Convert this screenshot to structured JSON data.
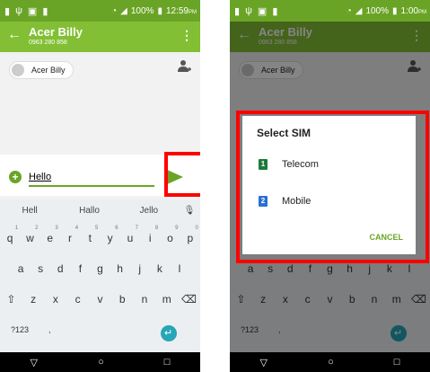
{
  "left": {
    "status": {
      "time": "12:59",
      "ampm": "PM",
      "battery": "100%"
    },
    "appbar": {
      "back": "←",
      "title": "Acer Billy",
      "subtitle": "0963 280 858",
      "menu": "⋮"
    },
    "recipient": {
      "chip": "Acer Billy"
    },
    "compose": {
      "plus": "+",
      "message": "Hello"
    },
    "suggestions": [
      "Hell",
      "Hallo",
      "Jello"
    ],
    "row1": [
      "q",
      "w",
      "e",
      "r",
      "t",
      "y",
      "u",
      "i",
      "o",
      "p"
    ],
    "row1_nums": [
      "1",
      "2",
      "3",
      "4",
      "5",
      "6",
      "7",
      "8",
      "9",
      "0"
    ],
    "row2": [
      "a",
      "s",
      "d",
      "f",
      "g",
      "h",
      "j",
      "k",
      "l"
    ],
    "row3": [
      "z",
      "x",
      "c",
      "v",
      "b",
      "n",
      "m"
    ],
    "sym": "?123",
    "comma": ","
  },
  "right": {
    "status": {
      "time": "1:00",
      "ampm": "PM",
      "battery": "100%"
    },
    "appbar": {
      "back": "←",
      "title": "Acer Billy",
      "subtitle": "0963 280 858",
      "menu": "⋮"
    },
    "recipient": {
      "chip": "Acer Billy"
    },
    "dialog": {
      "title": "Select SIM",
      "sims": [
        {
          "num": "1",
          "name": "Telecom",
          "color": "#1e7a3c"
        },
        {
          "num": "2",
          "name": "Mobile",
          "color": "#2a6fd1"
        }
      ],
      "cancel": "CANCEL"
    },
    "row2": [
      "a",
      "s",
      "d",
      "f",
      "g",
      "h",
      "j",
      "k",
      "l"
    ],
    "row3": [
      "z",
      "x",
      "c",
      "v",
      "b",
      "n",
      "m"
    ],
    "sym": "?123",
    "comma": ","
  },
  "nav": {
    "back": "▽",
    "home": "○",
    "recent": "□"
  }
}
